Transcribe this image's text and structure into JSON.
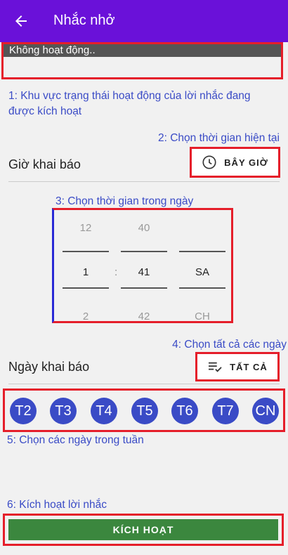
{
  "header": {
    "title": "Nhắc nhở",
    "back_icon": "arrow-back-icon"
  },
  "status": {
    "text": "Không hoạt động.."
  },
  "annotations": {
    "a1": "1: Khu vực trạng thái hoạt động của lời nhắc đang được kích hoạt",
    "a2": "2: Chọn thời gian hiện tại",
    "a3": "3: Chọn thời gian trong ngày",
    "a4": "4: Chọn tất cả các ngày",
    "a5": "5: Chọn các ngày trong tuần",
    "a6": "6: Kích hoạt lời nhắc"
  },
  "time_section": {
    "label": "Giờ khai báo",
    "now_button": "BÂY GIỜ",
    "now_icon": "clock-icon"
  },
  "picker": {
    "hour": {
      "prev": "12",
      "value": "1",
      "next": "2"
    },
    "separator": ":",
    "minute": {
      "prev": "40",
      "value": "41",
      "next": "42"
    },
    "ampm": {
      "prev": "",
      "value": "SA",
      "next": "CH"
    }
  },
  "days_section": {
    "label": "Ngày khai báo",
    "all_button": "TẤT CẢ",
    "all_icon": "checklist-icon"
  },
  "days": [
    "T2",
    "T3",
    "T4",
    "T5",
    "T6",
    "T7",
    "CN"
  ],
  "activate": {
    "label": "KÍCH HOẠT"
  },
  "colors": {
    "accent": "#6a11d9",
    "day": "#3a4bc6",
    "activate": "#3b873e",
    "highlight": "#e51e2a"
  }
}
